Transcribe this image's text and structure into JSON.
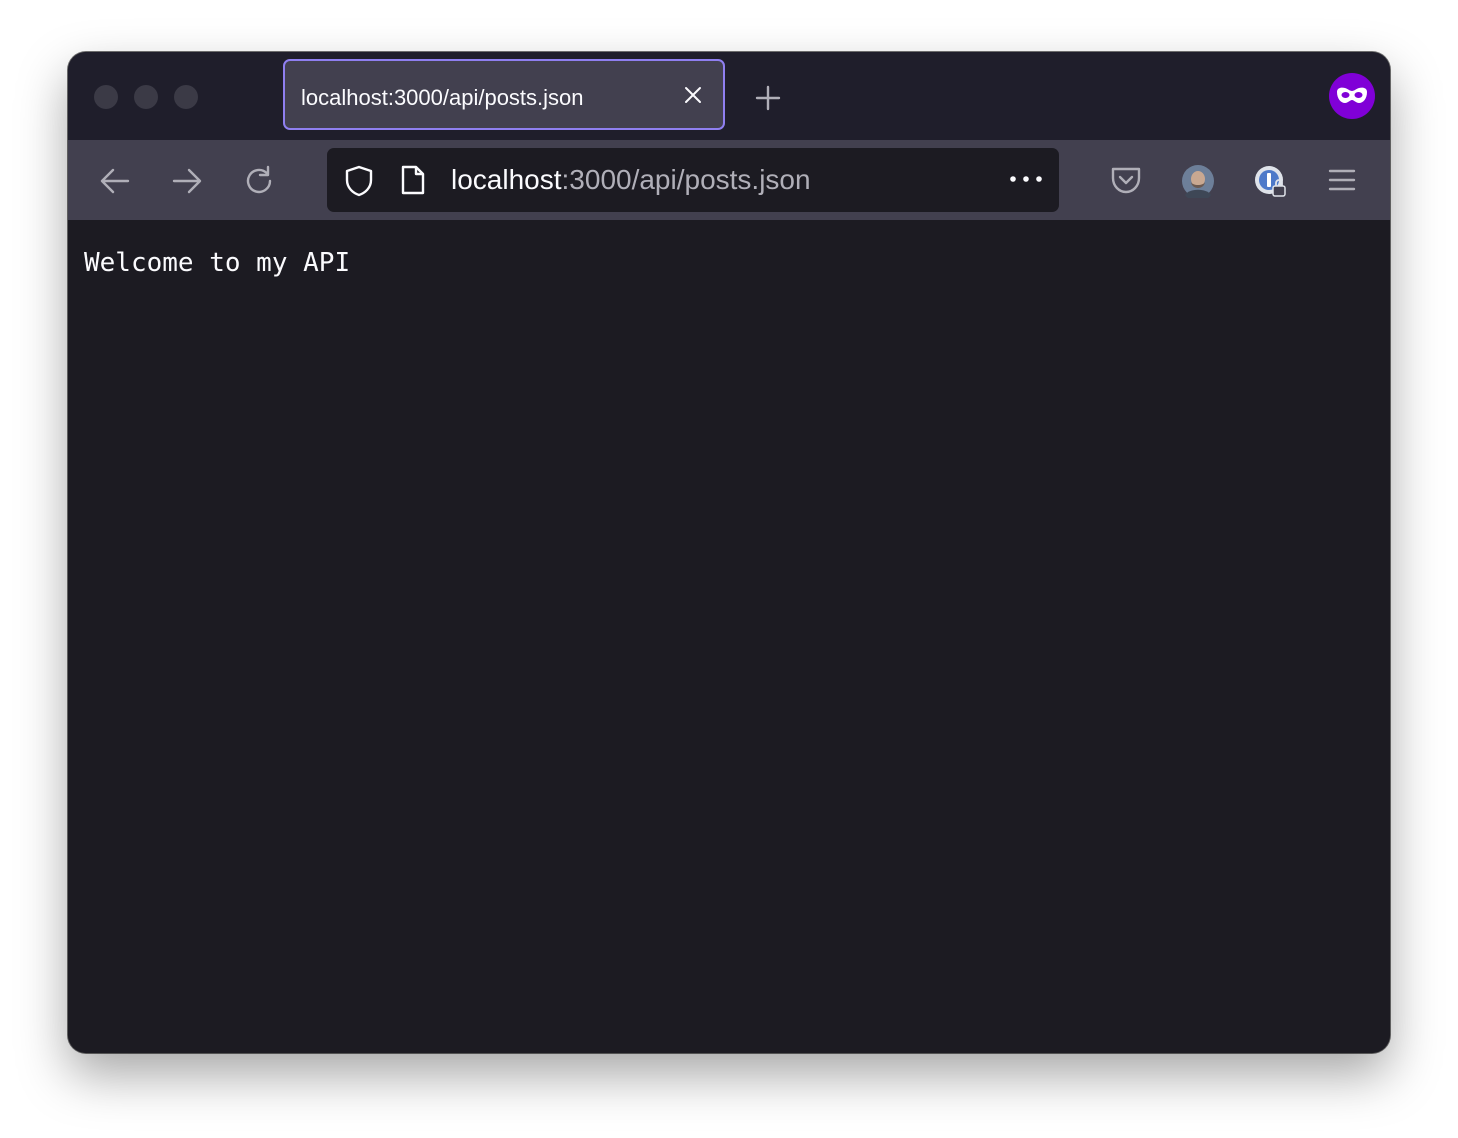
{
  "window": {
    "traffic_lights": [
      "close",
      "minimize",
      "zoom"
    ]
  },
  "tabs": [
    {
      "title": "localhost:3000/api/posts.json",
      "close_icon": "close-icon",
      "active": true
    }
  ],
  "new_tab_icon": "plus-icon",
  "private_browsing_icon": "private-mask-icon",
  "toolbar": {
    "back_icon": "arrow-left-icon",
    "forward_icon": "arrow-right-icon",
    "reload_icon": "reload-icon",
    "url": {
      "shield_icon": "shield-icon",
      "page_icon": "document-icon",
      "host": "localhost",
      "rest": ":3000/api/posts.json",
      "more_icon": "more-horizontal-icon"
    },
    "pocket_icon": "pocket-icon",
    "account_icon": "avatar",
    "password_manager_icon": "password-manager-icon",
    "menu_icon": "hamburger-menu-icon"
  },
  "page": {
    "text": "Welcome to my API"
  },
  "colors": {
    "tab_border": "#8f7ff0",
    "tab_bg": "#42404f",
    "toolbar_bg": "#42404f",
    "content_bg": "#1c1b22",
    "private_accent": "#8000d7"
  }
}
